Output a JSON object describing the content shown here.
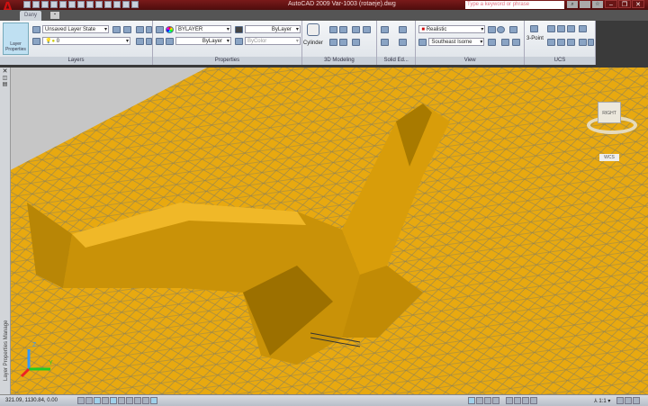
{
  "app": {
    "title": "AutoCAD 2009 Var-1003 (rotaeje).dwg",
    "search_placeholder": "Type a keyword or phrase"
  },
  "tabs": [
    {
      "label": "Dany"
    }
  ],
  "ribbon": {
    "layers": {
      "title": "Layers",
      "big_button": "Layer Properties",
      "layer_state": "Unsaved Layer State",
      "current_layer": "0"
    },
    "properties": {
      "title": "Properties",
      "color": "BYLAYER",
      "lineweight": "ByLayer",
      "linetype": "ByLayer",
      "plotstyle": "ByColor"
    },
    "modeling": {
      "title": "3D Modeling",
      "primitive": "Cylinder"
    },
    "solid_editing": {
      "title": "Solid Ed..."
    },
    "view": {
      "title": "View",
      "visual_style": "Realistic",
      "view_preset": "Southeast Isome"
    },
    "ucs": {
      "title": "UCS",
      "three_point": "3-Point"
    }
  },
  "viewcube": {
    "face": "RIGHT",
    "compass": "WCS"
  },
  "palette": {
    "label": "Layer Properties Manage"
  },
  "ucs_icon": {
    "z": "Z",
    "y": "Y"
  },
  "status": {
    "coordinates": "321.09, 1130.84, 0.00",
    "annotation_scale": "1:1"
  },
  "colors": {
    "terrain": "#e8a910",
    "titlebar": "#6a1515",
    "viewport_bg": "#c6c6c6",
    "mesh": "#7a7a6a"
  }
}
